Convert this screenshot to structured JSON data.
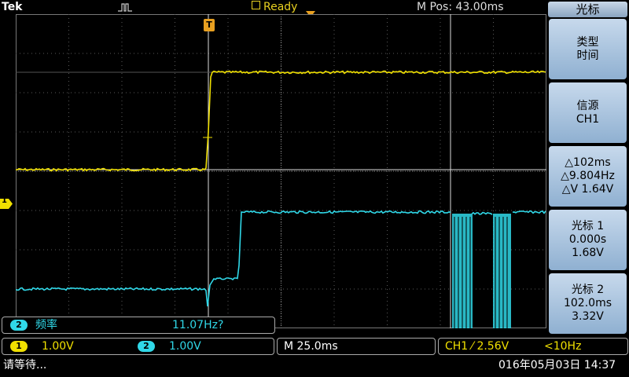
{
  "header": {
    "brand": "Tek",
    "status": "Ready",
    "mpos": "M Pos: 43.00ms"
  },
  "markers": {
    "trigger_tag": "T",
    "ch1_tag": "1"
  },
  "menu": {
    "title": "光标",
    "buttons": [
      {
        "lines": [
          "类型",
          "时间"
        ]
      },
      {
        "lines": [
          "信源",
          "CH1"
        ]
      },
      {
        "lines": [
          "△102ms",
          "△9.804Hz",
          "△V 1.64V"
        ]
      },
      {
        "lines": [
          "光标 1",
          "0.000s",
          "1.68V"
        ]
      },
      {
        "lines": [
          "光标 2",
          "102.0ms",
          "3.32V"
        ]
      }
    ]
  },
  "measurement": {
    "channel": "2",
    "label": "频率",
    "value": "11.07Hz?"
  },
  "status": {
    "ch1_num": "1",
    "ch1_scale": "1.00V",
    "ch2_num": "2",
    "ch2_scale": "1.00V",
    "timebase": "M 25.0ms",
    "trigger": "CH1 ⁄ 2.56V",
    "trigger_freq": "<10Hz"
  },
  "footer": {
    "message": "请等待...",
    "datetime": "016年05月03日 14:37"
  },
  "colors": {
    "ch1": "#f0e000",
    "ch2": "#30d8e8",
    "trigger": "#e8a020",
    "grid": "#5a5a5a"
  }
}
